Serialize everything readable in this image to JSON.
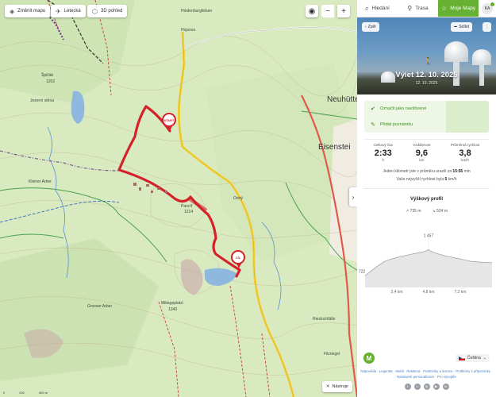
{
  "map": {
    "buttons": {
      "change_map": "Změnit mapu",
      "aerial": "Letecká",
      "view3d": "3D pohled",
      "tools": "Nástroje"
    },
    "pins": {
      "start": "START",
      "finish": "CÍL"
    },
    "labels": [
      {
        "id": "hojsova",
        "text": "Hojsova"
      },
      {
        "id": "spicak",
        "text": "Špičák"
      },
      {
        "id": "spicak_h",
        "text": "1202"
      },
      {
        "id": "jezerni",
        "text": "Jezerní stěna"
      },
      {
        "id": "hochwasser",
        "text": "Hindenburgfelsen"
      },
      {
        "id": "neuhutte",
        "text": "Neuhütte"
      },
      {
        "id": "eisenstein",
        "text": "Eisenstei"
      },
      {
        "id": "kamennyarber",
        "text": "Kleiner Arber"
      },
      {
        "id": "ostry",
        "text": "Ostrý"
      },
      {
        "id": "pancir",
        "text": "Pancíř"
      },
      {
        "id": "pancir_h",
        "text": "1214"
      },
      {
        "id": "mittagsplatzl",
        "text": "Mittagsplatzl"
      },
      {
        "id": "mitt_h",
        "text": "1340"
      },
      {
        "id": "gross",
        "text": "Grosser Arber"
      },
      {
        "id": "riesloch",
        "text": "Rieslochfälle"
      },
      {
        "id": "filzriegel",
        "text": "Filzriegel"
      }
    ],
    "scale": [
      "0",
      "200",
      "400 m"
    ]
  },
  "tabs": {
    "search": "Hledání",
    "route": "Trasa",
    "mymaps": "Moje Mapy",
    "avatar": "KA"
  },
  "hero": {
    "back": "Zpět",
    "share": "Sdílet",
    "title": "Výlet 12. 10. 2025",
    "date": "12. 10. 2025"
  },
  "actions": {
    "mark_visited": "Označit jako navštívené",
    "add_note": "Přidat poznámku"
  },
  "stats": {
    "total_time": {
      "label": "Celkový čas",
      "value": "2:33",
      "unit": "h"
    },
    "distance": {
      "label": "Vzdálenost",
      "value": "9,6",
      "unit": "km"
    },
    "avg_speed": {
      "label": "Průměrná rychlost",
      "value": "3,8",
      "unit": "km/h"
    }
  },
  "note": {
    "line1_pre": "Jeden kilometr jste v průměru urazili za",
    "line1_val": "15:56",
    "line1_post": "min",
    "line2_pre": "Vaše nejvyšší rychlost byla",
    "line2_val": "5",
    "line2_post": "km/h"
  },
  "profile": {
    "title": "Výškový profil",
    "ascent": "735 m",
    "descent": "524 m",
    "max_label": "1 457",
    "min_label": "722"
  },
  "chart_data": {
    "type": "area",
    "title": "Výškový profil",
    "x_ticks": [
      "2,4 km",
      "4,8 km",
      "7,2 km"
    ],
    "xlim": [
      0,
      9.6
    ],
    "ylim": [
      650,
      1500
    ],
    "x": [
      0,
      0.5,
      1,
      1.5,
      2,
      2.5,
      3,
      3.5,
      4,
      4.5,
      4.8,
      5,
      5.5,
      6,
      6.5,
      7,
      7.5,
      8,
      8.5,
      9,
      9.6
    ],
    "values": [
      900,
      1010,
      1120,
      1210,
      1260,
      1300,
      1330,
      1360,
      1390,
      1420,
      1457,
      1420,
      1370,
      1330,
      1300,
      1270,
      1240,
      1210,
      1195,
      1185,
      1180
    ]
  },
  "footer": {
    "language": "Čeština",
    "links": "Nápověda · Legenda · Mobil · Reklama · Podmínky a licence · Problémy s připomínky · Nastavení personalizace · Pro vývojáře"
  },
  "colors": {
    "accent": "#66b032",
    "route": "#d3222a"
  }
}
